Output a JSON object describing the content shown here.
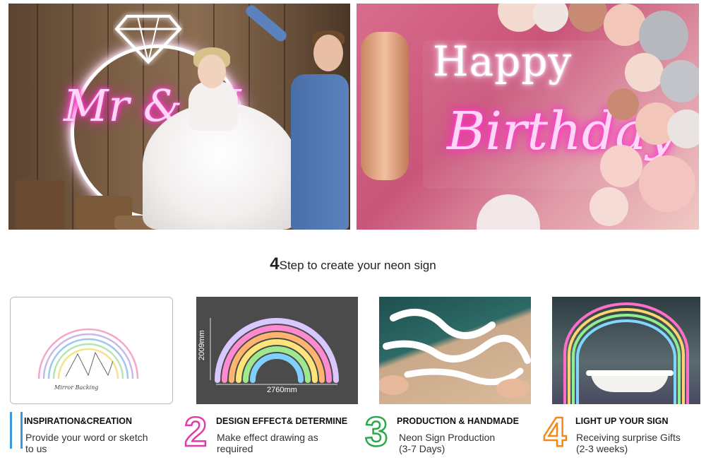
{
  "hero": {
    "wedding_sign_text": "Mr & M",
    "birthday_line1": "Happy",
    "birthday_line2": "Birthday"
  },
  "steps_title": {
    "number": "4",
    "text": "Step to create your neon sign"
  },
  "steps": [
    {
      "number": "",
      "title": "INSPIRATION&CREATION",
      "desc_line1": "Provide your word or sketch",
      "desc_line2": "to us",
      "image_caption": "Mirror Backing",
      "color": "#3a9ae0"
    },
    {
      "number": "2",
      "title": "DESIGN EFFECT& DETERMINE",
      "desc_line1": "Make effect drawing as",
      "desc_line2": "required",
      "width_label": "2760mm",
      "height_label": "2009mm",
      "color": "#e33aa8"
    },
    {
      "number": "3",
      "title": "PRODUCTION & HANDMADE",
      "desc_line1": "Neon Sign Production",
      "desc_line2": "(3-7 Days)",
      "color": "#2aa84a"
    },
    {
      "number": "4",
      "title": "LIGHT UP YOUR SIGN",
      "desc_line1": "Receiving surprise Gifts",
      "desc_line2": "(2-3 weeks)",
      "color": "#f28a1a"
    }
  ]
}
